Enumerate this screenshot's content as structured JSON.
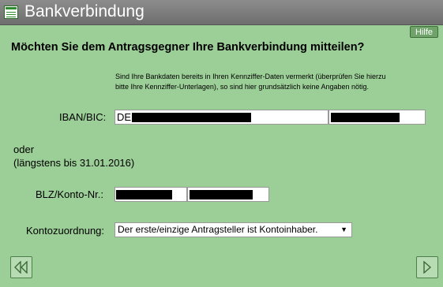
{
  "window": {
    "title": "Bankverbindung"
  },
  "help": {
    "label": "Hilfe"
  },
  "question": "Möchten Sie dem Antragsgegner Ihre Bankverbindung mitteilen?",
  "hint": {
    "line1": "Sind Ihre Bankdaten bereits in Ihren Kennziffer-Daten vermerkt (überprüfen Sie hierzu",
    "line2": "bitte Ihre Kennziffer-Unterlagen), so sind hier grundsätzlich keine Angaben nötig."
  },
  "iban": {
    "label": "IBAN/BIC:",
    "prefix": "DE"
  },
  "oder": {
    "line1": "oder",
    "line2": "(längstens bis 31.01.2016)"
  },
  "blz": {
    "label": "BLZ/Konto-Nr.:"
  },
  "kontozuordnung": {
    "label": "Kontozuordnung:",
    "selected": "Der erste/einzige Antragsteller ist Kontoinhaber."
  },
  "icons": {
    "app": "form-icon",
    "back": "double-left-arrow-icon",
    "next": "right-arrow-icon",
    "dropdown": "dropdown-arrow-icon"
  },
  "colors": {
    "background": "#9ccf97",
    "titlebar": "#777777",
    "redaction": "#000000"
  }
}
